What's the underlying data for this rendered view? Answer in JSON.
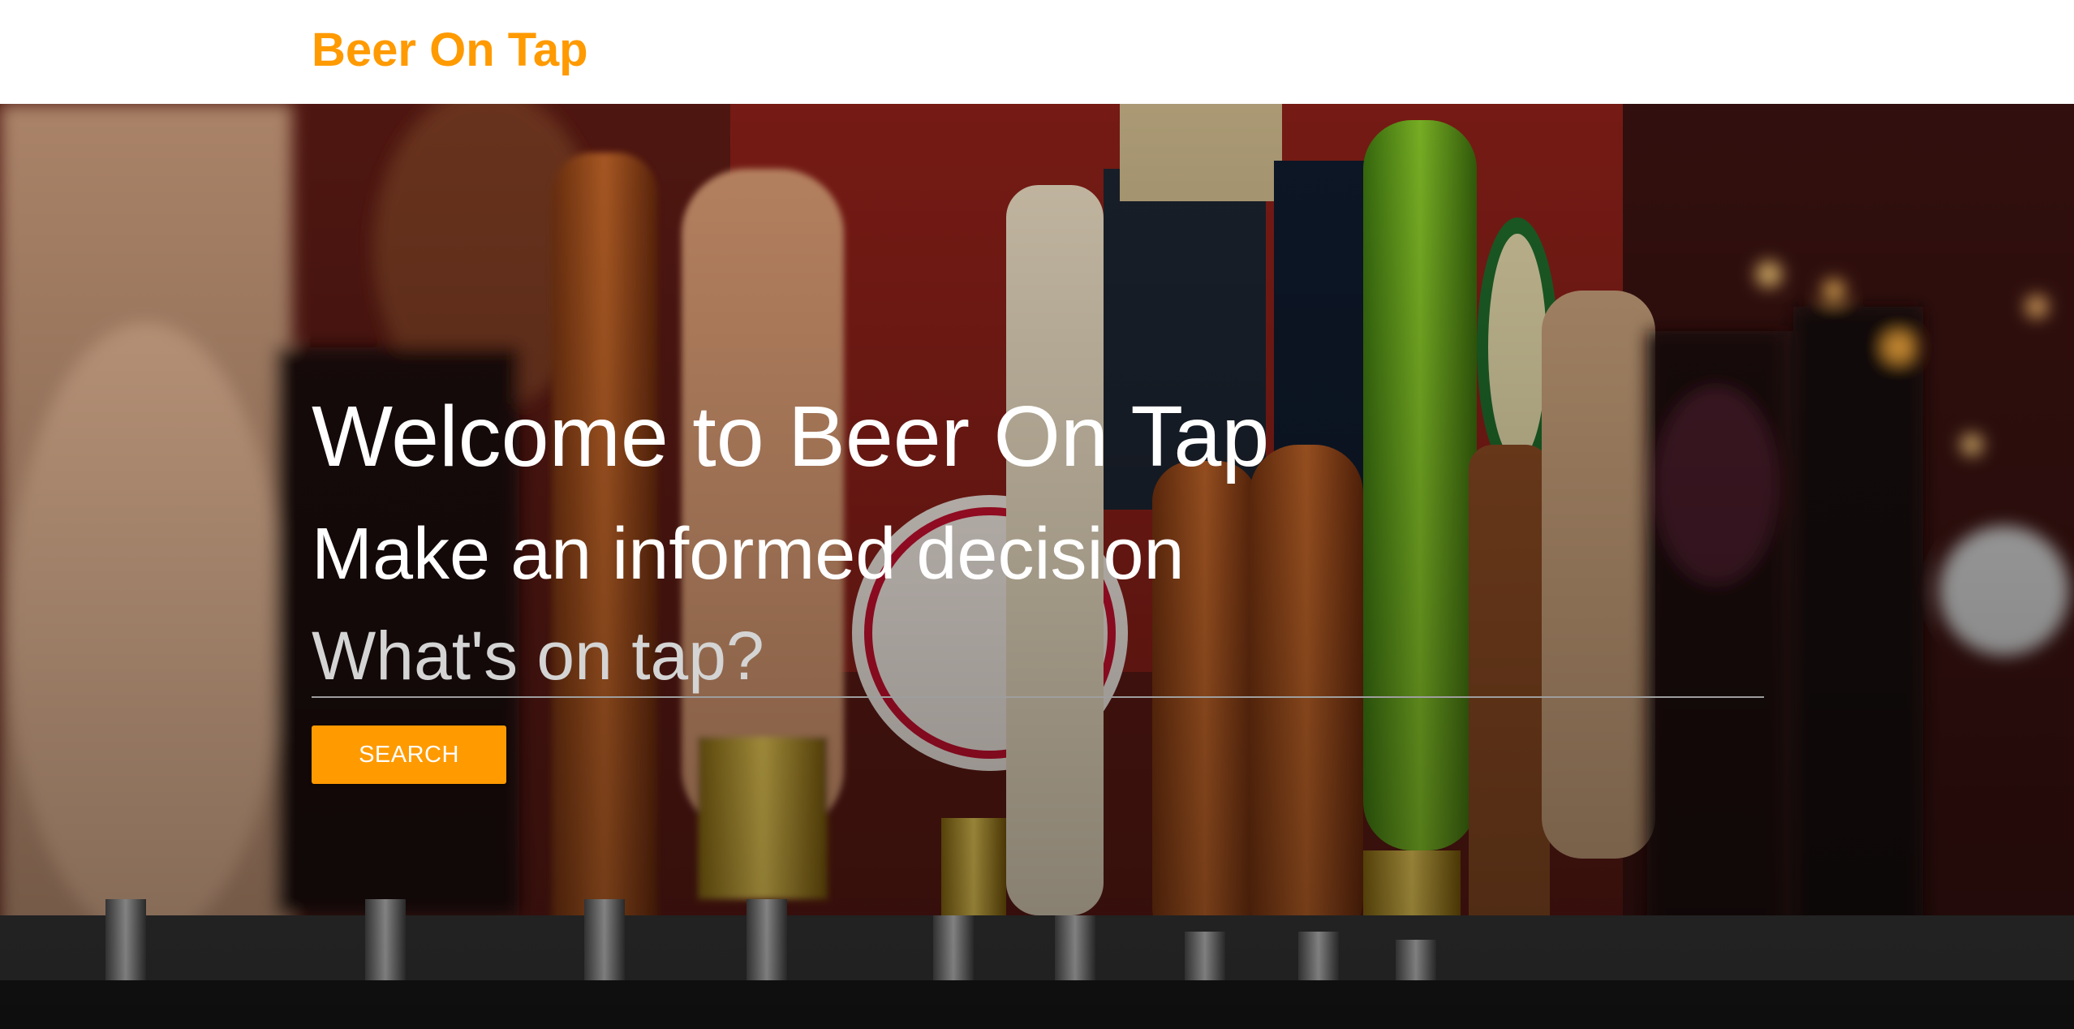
{
  "navbar": {
    "brand": "Beer On Tap"
  },
  "hero": {
    "title": "Welcome to Beer On Tap",
    "tagline": "Make an informed decision",
    "search": {
      "placeholder": "What's on tap?",
      "value": ""
    },
    "search_button_label": "SEARCH",
    "background": "beer-taps-photo"
  },
  "colors": {
    "accent": "#ff9a00",
    "navbar_bg": "#ffffff",
    "hero_text": "#ffffff"
  }
}
